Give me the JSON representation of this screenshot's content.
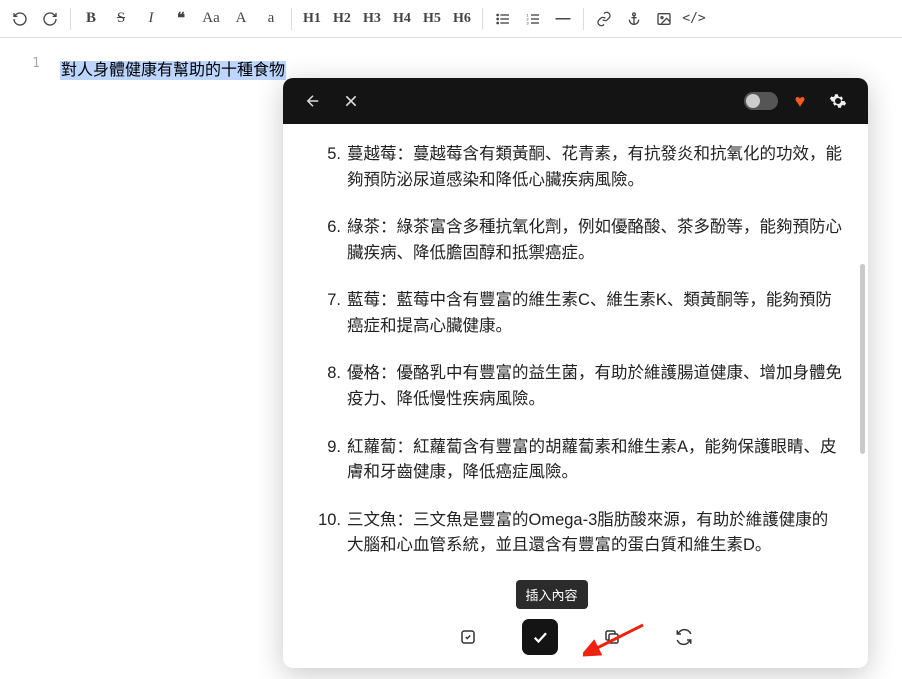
{
  "toolbar": {
    "undo": "↺",
    "redo": "↻",
    "bold": "B",
    "strike": "S",
    "italic": "I",
    "quote": "❝",
    "case1": "Aa",
    "case2": "A",
    "case3": "a",
    "h1": "H1",
    "h2": "H2",
    "h3": "H3",
    "h4": "H4",
    "h5": "H5",
    "h6": "H6",
    "ul": "≡",
    "ol": "≡",
    "hr": "―",
    "link": "🔗",
    "anchor": "⚓",
    "image": "🖼",
    "code": "</>"
  },
  "editor": {
    "line_number": "1",
    "selected_text": "對人身體健康有幫助的十種食物"
  },
  "popup": {
    "items": [
      {
        "num": "5.",
        "text": "蔓越莓：蔓越莓含有類黃酮、花青素，有抗發炎和抗氧化的功效，能夠預防泌尿道感染和降低心臟疾病風險。"
      },
      {
        "num": "6.",
        "text": "綠茶：綠茶富含多種抗氧化劑，例如優酪酸、茶多酚等，能夠預防心臟疾病、降低膽固醇和抵禦癌症。"
      },
      {
        "num": "7.",
        "text": "藍莓：藍莓中含有豐富的維生素C、維生素K、類黃酮等，能夠預防癌症和提高心臟健康。"
      },
      {
        "num": "8.",
        "text": "優格：優酪乳中有豐富的益生菌，有助於維護腸道健康、增加身體免疫力、降低慢性疾病風險。"
      },
      {
        "num": "9.",
        "text": "紅蘿蔔：紅蘿蔔含有豐富的胡蘿蔔素和維生素A，能夠保護眼睛、皮膚和牙齒健康，降低癌症風險。"
      },
      {
        "num": "10.",
        "text": "三文魚：三文魚是豐富的Omega-3脂肪酸來源，有助於維護健康的大腦和心血管系統，並且還含有豐富的蛋白質和維生素D。"
      }
    ],
    "tooltip": "插入內容"
  }
}
